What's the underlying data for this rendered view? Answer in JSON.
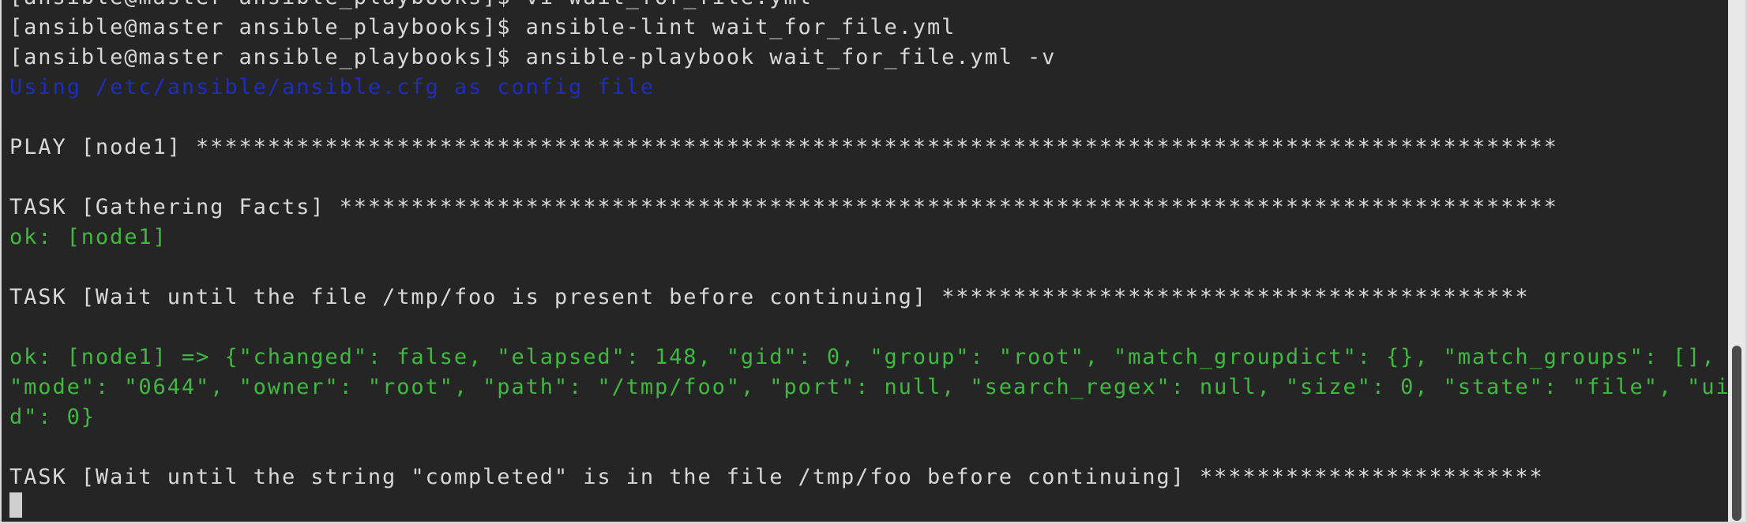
{
  "terminal": {
    "lines": [
      {
        "text": "[ansible@master ansible_playbooks]$ vi wait_for_file.yml",
        "color": "white"
      },
      {
        "text": "[ansible@master ansible_playbooks]$ ansible-lint wait_for_file.yml",
        "color": "white"
      },
      {
        "text": "[ansible@master ansible_playbooks]$ ansible-playbook wait_for_file.yml -v",
        "color": "white"
      },
      {
        "text": "Using /etc/ansible/ansible.cfg as config file",
        "color": "blue"
      },
      {
        "text": "",
        "color": "white"
      },
      {
        "text": "PLAY [node1] ***********************************************************************************************",
        "color": "white"
      },
      {
        "text": "",
        "color": "white"
      },
      {
        "text": "TASK [Gathering Facts] *************************************************************************************",
        "color": "white"
      },
      {
        "text": "ok: [node1]",
        "color": "green"
      },
      {
        "text": "",
        "color": "white"
      },
      {
        "text": "TASK [Wait until the file /tmp/foo is present before continuing] *****************************************",
        "color": "white"
      },
      {
        "text": "",
        "color": "white"
      },
      {
        "text": "ok: [node1] => {\"changed\": false, \"elapsed\": 148, \"gid\": 0, \"group\": \"root\", \"match_groupdict\": {}, \"match_groups\": [],",
        "color": "green"
      },
      {
        "text": "\"mode\": \"0644\", \"owner\": \"root\", \"path\": \"/tmp/foo\", \"port\": null, \"search_regex\": null, \"size\": 0, \"state\": \"file\", \"ui",
        "color": "green"
      },
      {
        "text": "d\": 0}",
        "color": "green"
      },
      {
        "text": "",
        "color": "white"
      },
      {
        "text": "TASK [Wait until the string \"completed\" is in the file /tmp/foo before continuing] ************************",
        "color": "white"
      }
    ]
  },
  "colors": {
    "background": "#252525",
    "text": "#d8d8d8",
    "blue": "#1f2dbd",
    "green": "#3fb93f"
  }
}
